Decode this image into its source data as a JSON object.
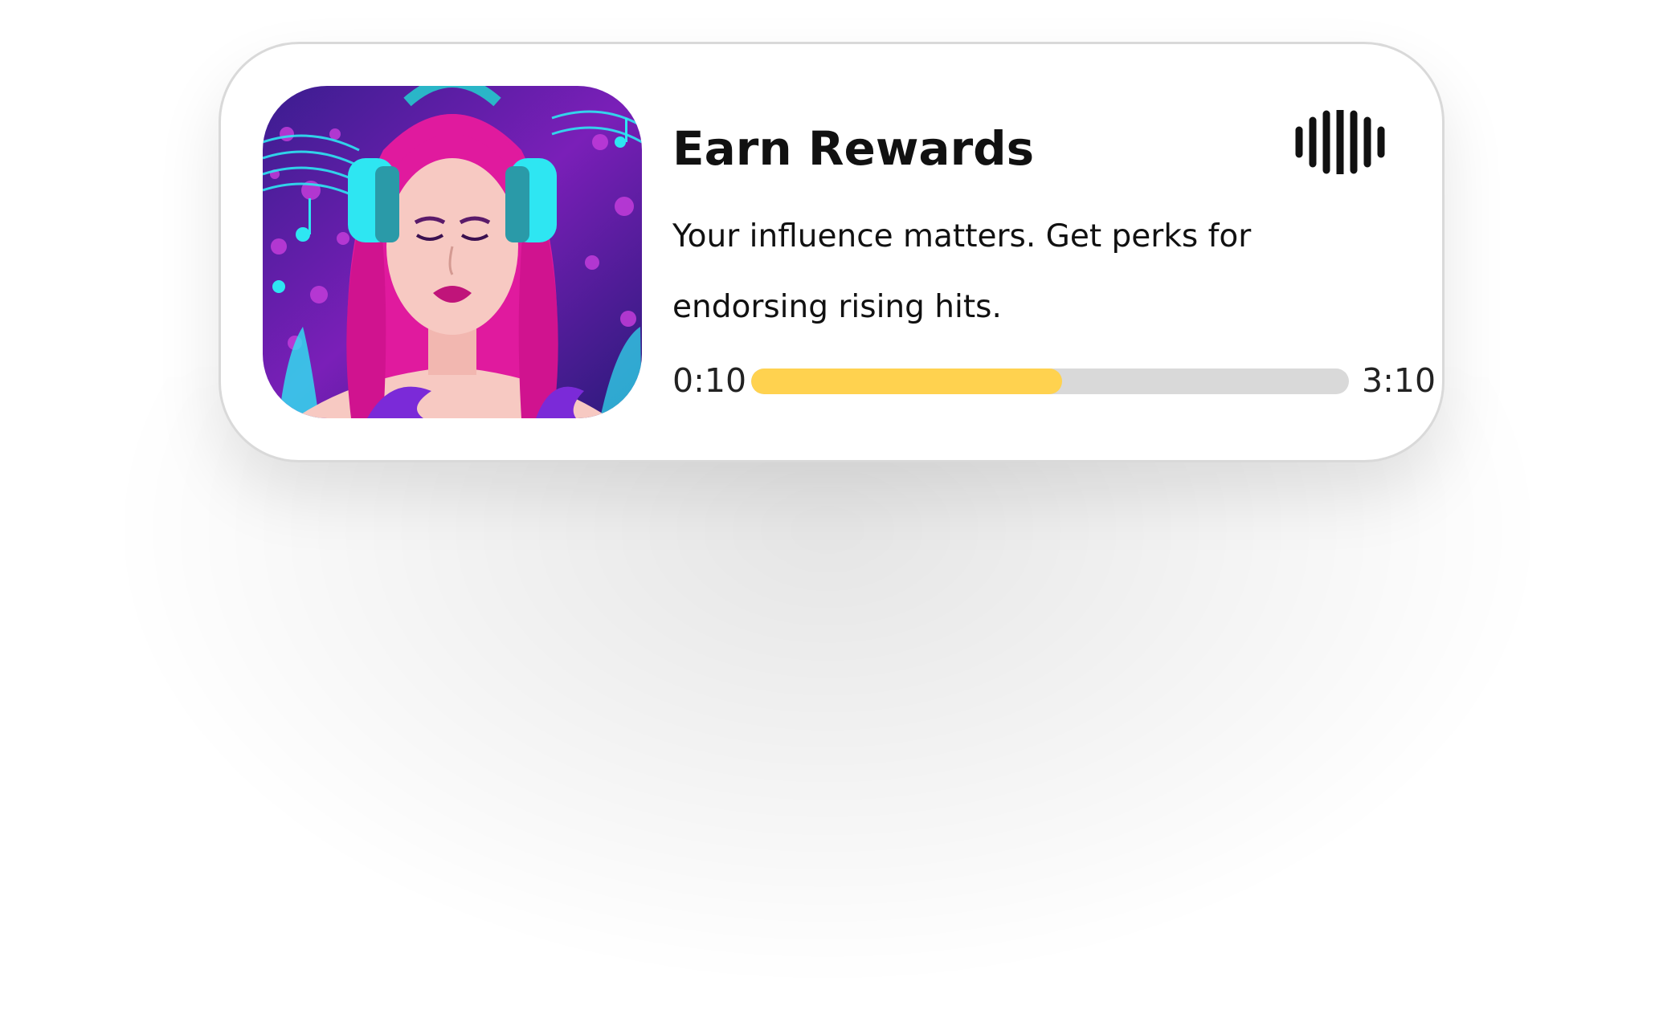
{
  "card": {
    "title": "Earn Rewards",
    "description": "Your influence matters. Get perks for endorsing rising hits.",
    "artwork_icon": "album-art-woman-headphones",
    "action_icon": "audio-wave-icon"
  },
  "player": {
    "elapsed": "0:10",
    "total": "3:10",
    "progress_fraction": 0.52
  },
  "colors": {
    "progress_fill": "#ffd24f",
    "progress_track": "#d9d9d9"
  }
}
